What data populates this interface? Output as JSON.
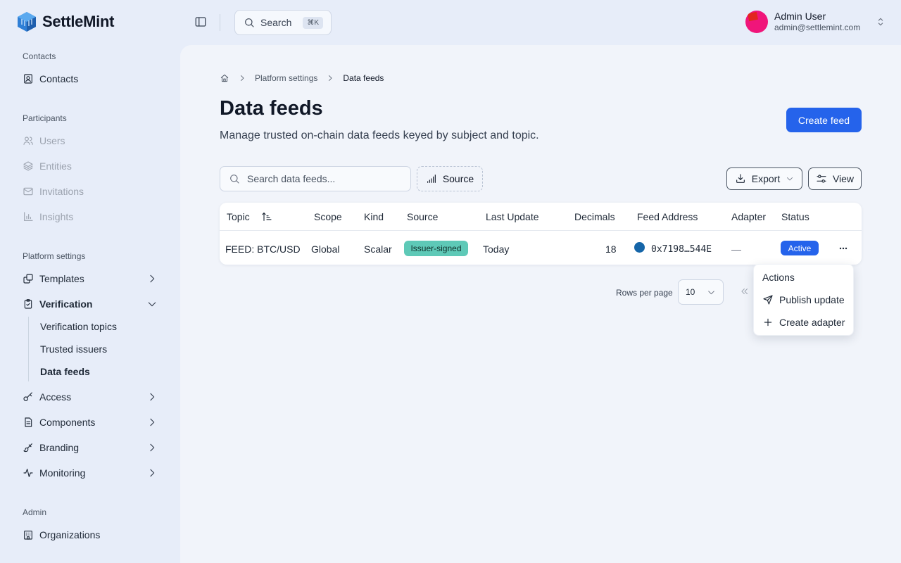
{
  "app": {
    "name": "SettleMint",
    "brand_color": "#2563eb"
  },
  "topbar": {
    "search_label": "Search",
    "search_shortcut": "⌘K",
    "user": {
      "name": "Admin User",
      "email": "admin@settlemint.com"
    }
  },
  "sidebar": {
    "sections": [
      {
        "title": "Contacts",
        "items": [
          {
            "label": "Contacts",
            "icon": "contact-card-icon"
          }
        ]
      },
      {
        "title": "Participants",
        "items": [
          {
            "label": "Users",
            "icon": "users-icon",
            "disabled": true
          },
          {
            "label": "Entities",
            "icon": "layers-icon",
            "disabled": true
          },
          {
            "label": "Invitations",
            "icon": "mail-icon",
            "disabled": true
          },
          {
            "label": "Insights",
            "icon": "bar-chart-icon",
            "disabled": true
          }
        ]
      },
      {
        "title": "Platform settings",
        "items": [
          {
            "label": "Templates",
            "icon": "templates-icon",
            "expandable": true
          },
          {
            "label": "Verification",
            "icon": "clipboard-check-icon",
            "expanded": true,
            "children": [
              "Verification topics",
              "Trusted issuers",
              "Data feeds"
            ],
            "active_child": "Data feeds"
          },
          {
            "label": "Access",
            "icon": "key-icon",
            "expandable": true
          },
          {
            "label": "Components",
            "icon": "file-text-icon",
            "expandable": true
          },
          {
            "label": "Branding",
            "icon": "brush-icon",
            "expandable": true
          },
          {
            "label": "Monitoring",
            "icon": "activity-icon",
            "expandable": true
          }
        ]
      },
      {
        "title": "Admin",
        "items": [
          {
            "label": "Organizations",
            "icon": "building-icon"
          }
        ]
      }
    ]
  },
  "breadcrumb": {
    "items": [
      "Platform settings",
      "Data feeds"
    ]
  },
  "page": {
    "title": "Data feeds",
    "subtitle": "Manage trusted on-chain data feeds keyed by subject and topic.",
    "create_label": "Create feed"
  },
  "toolbar": {
    "search_placeholder": "Search data feeds...",
    "source_filter": "Source",
    "export_label": "Export",
    "view_label": "View"
  },
  "table": {
    "columns": [
      "Topic",
      "Scope",
      "Kind",
      "Source",
      "Last Update",
      "Decimals",
      "Feed Address",
      "Adapter",
      "Status"
    ],
    "rows": [
      {
        "topic": "FEED: BTC/USD",
        "scope": "Global",
        "kind": "Scalar",
        "source": "Issuer-signed",
        "last_update": "Today",
        "decimals": "18",
        "feed_address": "0x7198…544E",
        "adapter": "—",
        "status": "Active"
      }
    ]
  },
  "pagination": {
    "rows_per_page_label": "Rows per page",
    "rows_per_page": "10"
  },
  "row_menu": {
    "header": "Actions",
    "items": [
      {
        "label": "Publish update",
        "icon": "send-icon"
      },
      {
        "label": "Create adapter",
        "icon": "plus-icon"
      }
    ]
  },
  "colors": {
    "source_badge_bg": "#5ec9b7",
    "status_badge_bg": "#2563eb",
    "address_dot": "#1565a8"
  }
}
